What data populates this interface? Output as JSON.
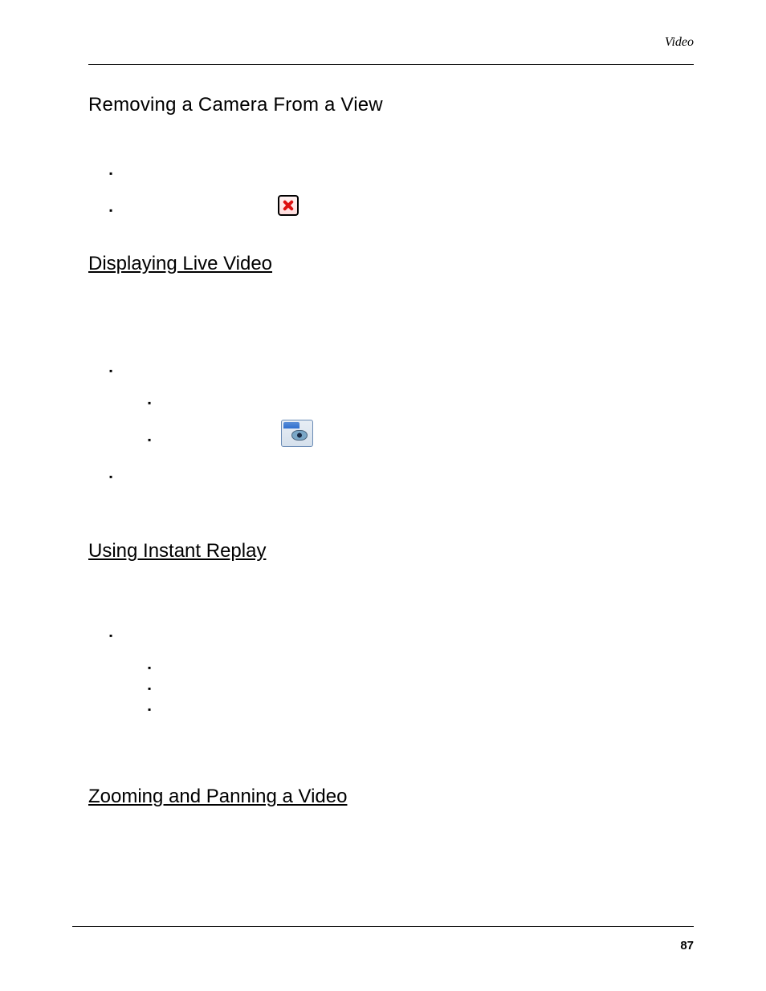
{
  "header": {
    "section": "Video"
  },
  "sections": {
    "removing": {
      "title": "Removing a Camera From a View"
    },
    "displaying": {
      "title": "Displaying Live Video"
    },
    "instant_replay": {
      "title": "Using Instant Replay"
    },
    "zoom_pan": {
      "title": "Zooming and Panning a Video"
    }
  },
  "footer": {
    "page_number": "87"
  }
}
